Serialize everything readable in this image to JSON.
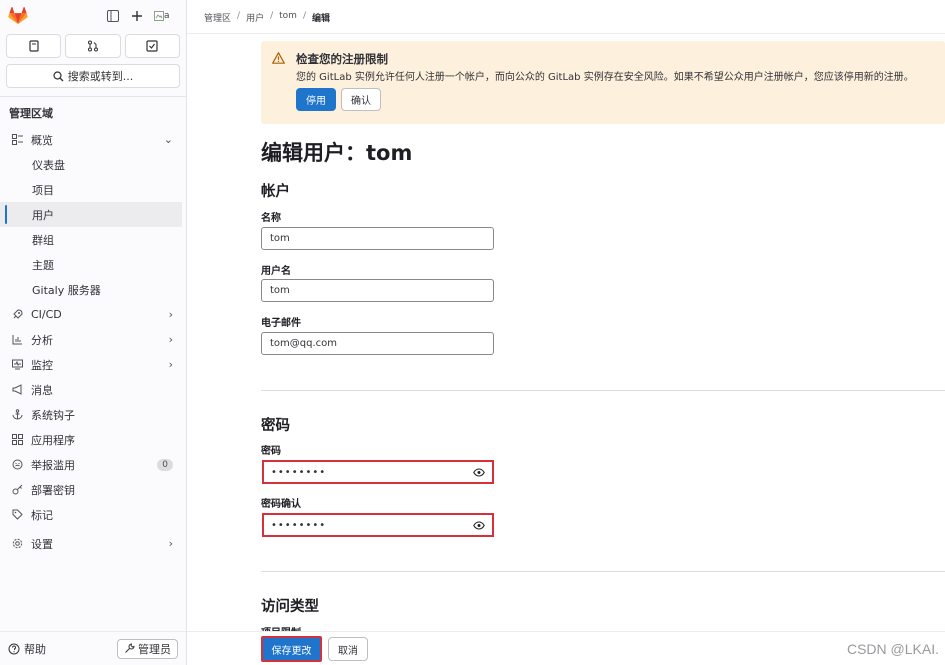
{
  "sidebar": {
    "search_label": "搜索或转到...",
    "section_title": "管理区域",
    "items": [
      {
        "label": "概览",
        "icon": "overview-icon",
        "chevron": "⌄"
      },
      {
        "label": "仪表盘"
      },
      {
        "label": "项目"
      },
      {
        "label": "用户"
      },
      {
        "label": "群组"
      },
      {
        "label": "主题"
      },
      {
        "label": "Gitaly 服务器"
      },
      {
        "label": "CI/CD",
        "icon": "rocket-icon"
      },
      {
        "label": "分析",
        "icon": "chart-icon"
      },
      {
        "label": "监控",
        "icon": "monitor-icon"
      },
      {
        "label": "消息",
        "icon": "bullhorn-icon"
      },
      {
        "label": "系统钩子",
        "icon": "anchor-icon"
      },
      {
        "label": "应用程序",
        "icon": "apps-icon"
      },
      {
        "label": "举报滥用",
        "icon": "abuse-icon",
        "badge": "0"
      },
      {
        "label": "部署密钥",
        "icon": "key-icon"
      },
      {
        "label": "标记",
        "icon": "label-icon"
      },
      {
        "label": "设置",
        "icon": "settings-icon"
      }
    ],
    "help_label": "帮助",
    "admin_label": "管理员"
  },
  "breadcrumb": [
    "管理区",
    "用户",
    "tom",
    "编辑"
  ],
  "alert": {
    "title": "检查您的注册限制",
    "body": "您的 GitLab 实例允许任何人注册一个帐户，而向公众的 GitLab 实例存在安全风险。如果不希望公众用户注册帐户，您应该停用新的注册。",
    "primary_label": "停用",
    "secondary_label": "确认"
  },
  "page_title": "编辑用户：tom",
  "account": {
    "heading": "帐户",
    "name_label": "名称",
    "name_value": "tom",
    "username_label": "用户名",
    "username_value": "tom",
    "email_label": "电子邮件",
    "email_value": "tom@qq.com"
  },
  "password": {
    "heading": "密码",
    "password_label": "密码",
    "password_mask": "••••••••",
    "confirm_label": "密码确认",
    "confirm_mask": "••••••••"
  },
  "access": {
    "heading": "访问类型",
    "next_label": "项目限制"
  },
  "footer": {
    "save_label": "保存更改",
    "cancel_label": "取消",
    "watermark": "CSDN @LKAI."
  },
  "colors": {
    "primary": "#1f75cb",
    "highlight": "#d6303a",
    "alert_bg": "#fdf1dd"
  }
}
